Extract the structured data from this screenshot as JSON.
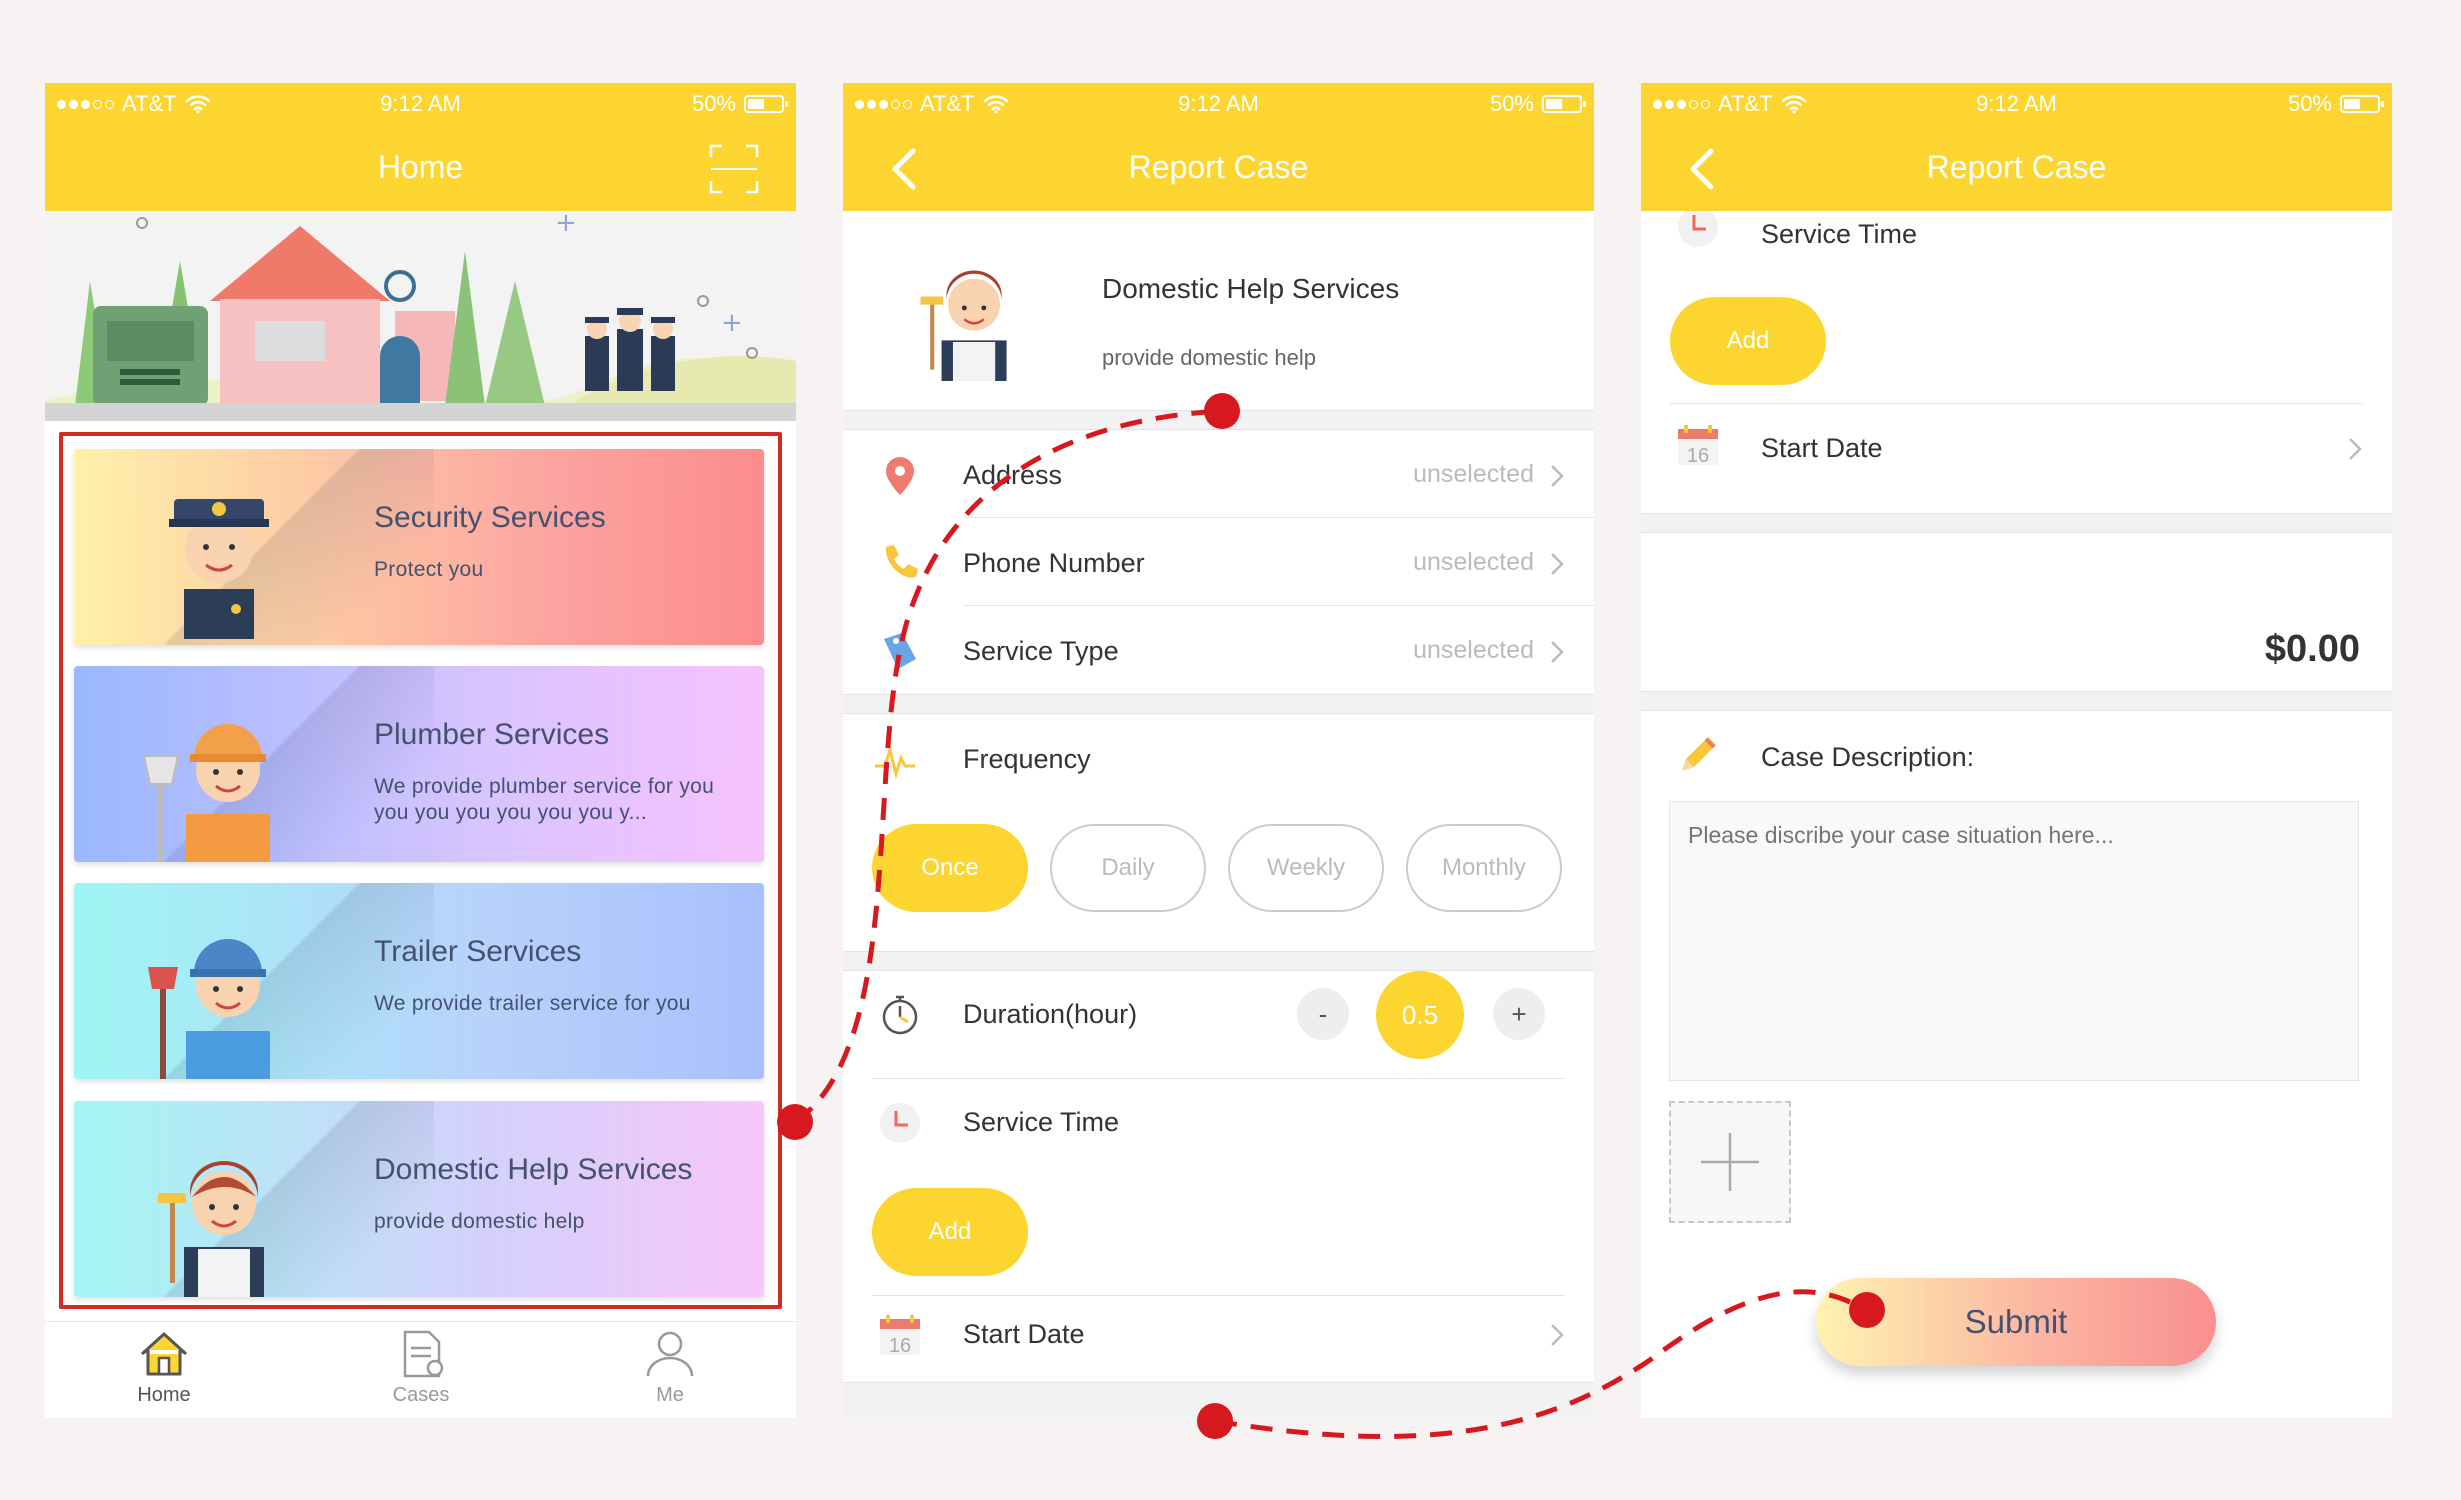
{
  "status": {
    "carrier": "AT&T",
    "time": "9:12 AM",
    "battery": "50%"
  },
  "home": {
    "title": "Home",
    "cards": [
      {
        "title": "Security Services",
        "desc": "Protect you"
      },
      {
        "title": "Plumber Services",
        "desc": "We provide plumber service for you you you you you you you y..."
      },
      {
        "title": "Trailer Services",
        "desc": "We provide trailer service for you"
      },
      {
        "title": "Domestic Help Services",
        "desc": "provide domestic help"
      }
    ],
    "tabs": [
      {
        "label": "Home"
      },
      {
        "label": "Cases"
      },
      {
        "label": "Me"
      }
    ]
  },
  "report": {
    "title": "Report Case",
    "service_title": "Domestic Help Services",
    "service_desc": "provide domestic help",
    "address_label": "Address",
    "phone_label": "Phone Number",
    "type_label": "Service Type",
    "unselected": "unselected",
    "frequency_label": "Frequency",
    "frequency_options": [
      "Once",
      "Daily",
      "Weekly",
      "Monthly"
    ],
    "frequency_selected": "Once",
    "duration_label": "Duration(hour)",
    "duration_minus": "-",
    "duration_value": "0.5",
    "duration_plus": "+",
    "service_time_label": "Service Time",
    "add_label": "Add",
    "start_date_label": "Start Date",
    "calendar_day": "16"
  },
  "report2": {
    "price": "$0.00",
    "case_desc_label": "Case Description:",
    "case_desc_placeholder": "Please discribe your case situation here...",
    "submit_label": "Submit"
  },
  "colors": {
    "accent": "#fdd530",
    "flow": "#d7191f",
    "text_dark": "#44516f"
  }
}
